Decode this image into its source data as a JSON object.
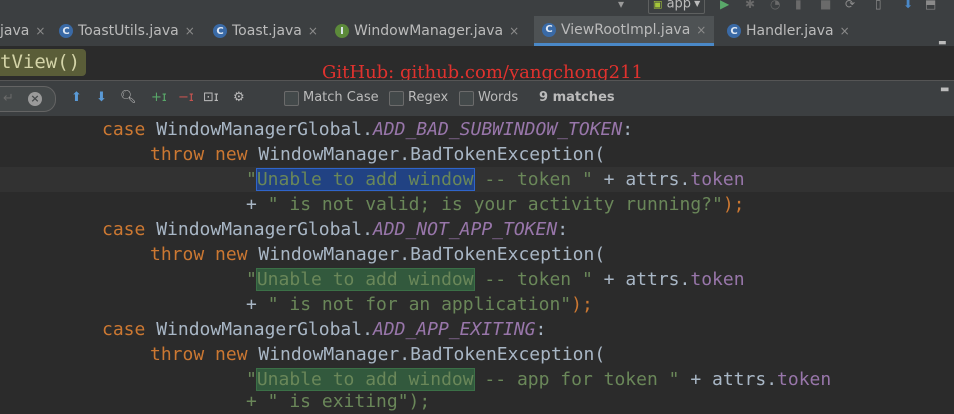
{
  "toolbar": {
    "run_config": "app",
    "icons": [
      "android-app-icon",
      "run-icon",
      "debug-icon",
      "profile-icon",
      "coverage-icon",
      "stop-icon",
      "sync-icon",
      "avd-icon",
      "sdk-icon",
      "update-icon"
    ]
  },
  "tabs": [
    {
      "label": "java",
      "icon": "java-class-icon",
      "active": false
    },
    {
      "label": "ToastUtils.java",
      "icon": "java-class-icon",
      "active": false
    },
    {
      "label": "Toast.java",
      "icon": "java-class-icon",
      "active": false
    },
    {
      "label": "WindowManager.java",
      "icon": "java-interface-icon",
      "active": false
    },
    {
      "label": "ViewRootImpl.java",
      "icon": "java-class-icon",
      "active": true
    },
    {
      "label": "Handler.java",
      "icon": "java-class-icon",
      "active": false
    }
  ],
  "tab_icon_class": "C",
  "tab_icon_interface": "I",
  "tab_close": "×",
  "breadcrumb": "tView()",
  "watermark": "GitHub: github.com/yangchong211",
  "find": {
    "query": "",
    "options": [
      {
        "label": "Match Case",
        "checked": false
      },
      {
        "label": "Regex",
        "checked": false
      },
      {
        "label": "Words",
        "checked": false
      }
    ],
    "match_count": "9 matches"
  },
  "code": {
    "case1_kw": "case",
    "case1_cls": "WindowManagerGlobal.",
    "case1_const": "ADD_BAD_SUBWINDOW_TOKEN",
    "case1_colon": ":",
    "throw1_kw": "throw new",
    "throw1_rest": " WindowManager.BadTokenException(",
    "l3_q": "\"",
    "l3_match": "Unable to add window",
    "l3_str": " -- token \"",
    "l3_plus": " + attrs.",
    "l3_field": "token",
    "l4_plus": "+ ",
    "l4_str": "\" is not valid; is your activity running?\"",
    "l4_end": ");",
    "case2_kw": "case",
    "case2_cls": "WindowManagerGlobal.",
    "case2_const": "ADD_NOT_APP_TOKEN",
    "case2_colon": ":",
    "throw2_kw": "throw new",
    "throw2_rest": " WindowManager.BadTokenException(",
    "l7_q": "\"",
    "l7_match": "Unable to add window",
    "l7_str": " -- token \"",
    "l7_plus": " + attrs.",
    "l7_field": "token",
    "l8_plus": "+ ",
    "l8_str": "\" is not for an application\"",
    "l8_end": ");",
    "case3_kw": "case",
    "case3_cls": "WindowManagerGlobal.",
    "case3_const": "ADD_APP_EXITING",
    "case3_colon": ":",
    "throw3_kw": "throw new",
    "throw3_rest": " WindowManager.BadTokenException(",
    "l11_q": "\"",
    "l11_match": "Unable to add window",
    "l11_str": " -- app for token \"",
    "l11_plus": " + attrs.",
    "l11_field": "token",
    "l12_partial": "+ \" is exiting\");"
  },
  "colors": {
    "keyword": "#cc7832",
    "constant": "#9876aa",
    "string": "#6a8759",
    "text": "#a9b7c6",
    "match_highlight": "#32593d",
    "current_match": "#214283",
    "watermark": "#e0322e",
    "active_tab_underline": "#4a88c7"
  }
}
